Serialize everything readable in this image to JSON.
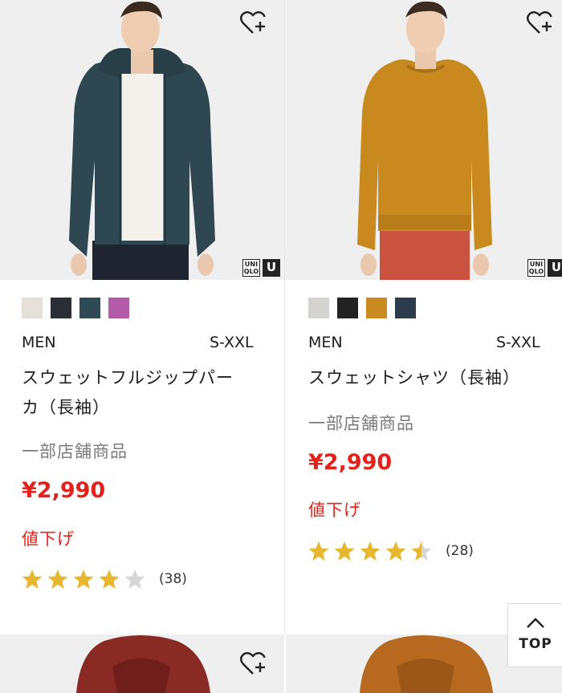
{
  "products": [
    {
      "swatches": [
        "#e6e1d8",
        "#2a2d33",
        "#2f4a57",
        "#b35aa9"
      ],
      "gender": "MEN",
      "size": "S-XXL",
      "name_line1": "スウェットフルジップパー",
      "name_line2": "カ（長袖）",
      "store": "一部店舗商品",
      "price": "¥2,990",
      "sale": "値下げ",
      "rating_value": 4,
      "review_count": "(38)",
      "brand_label": "UNI QLO",
      "brand_u": "U"
    },
    {
      "swatches": [
        "#d5d3d0",
        "#222222",
        "#c98a1f",
        "#2c3b4a"
      ],
      "gender": "MEN",
      "size": "S-XXL",
      "name_line1": "スウェットシャツ（長袖）",
      "store": "一部店舗商品",
      "price": "¥2,990",
      "sale": "値下げ",
      "rating_value": 4.5,
      "review_count": "(28)",
      "brand_label": "UNI QLO",
      "brand_u": "U"
    }
  ],
  "top_button": {
    "label": "TOP"
  },
  "colors": {
    "price_red": "#e3221c",
    "star_gold": "#e8b730",
    "star_gray": "#d6d6d6"
  },
  "icons": {
    "wishlist": "heart-plus-icon",
    "scroll_top": "chevron-up-icon"
  }
}
